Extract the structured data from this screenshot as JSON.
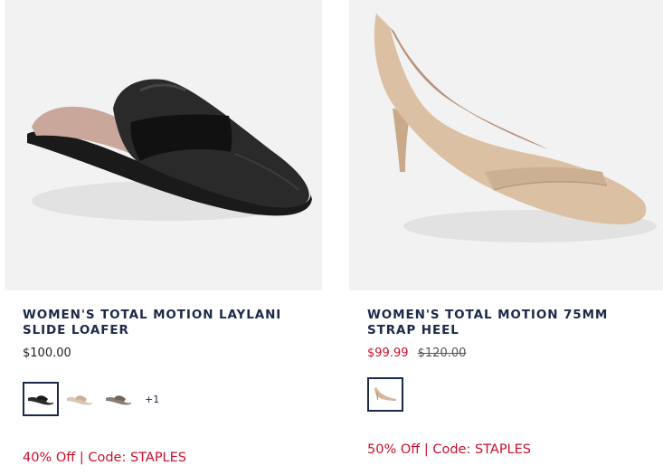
{
  "products": [
    {
      "title": "WOMEN'S TOTAL MOTION LAYLANI SLIDE LOAFER",
      "price": "$100.00",
      "swatches": [
        {
          "name": "black",
          "color": "#2b2b2b"
        },
        {
          "name": "nude",
          "color": "#d9c5b0"
        },
        {
          "name": "taupe",
          "color": "#8a7d72"
        }
      ],
      "more_swatches": "+1",
      "promo": "40% Off | Code: STAPLES"
    },
    {
      "title": "WOMEN'S TOTAL MOTION 75MM STRAP HEEL",
      "sale_price": "$99.99",
      "original_price": "$120.00",
      "swatches": [
        {
          "name": "nude",
          "color": "#d4b89a"
        }
      ],
      "promo": "50% Off | Code: STAPLES"
    }
  ],
  "colors": {
    "navy": "#1b2a4a",
    "sale_red": "#c8102e",
    "image_bg": "#f2f2f2"
  }
}
